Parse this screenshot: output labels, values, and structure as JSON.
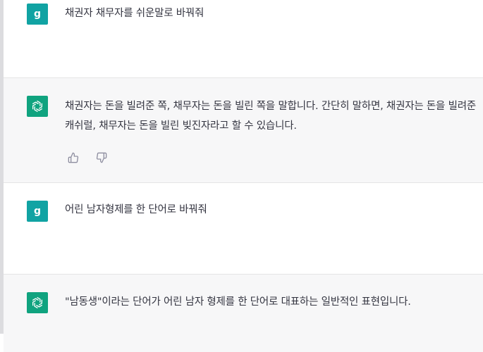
{
  "conversation": [
    {
      "role": "user",
      "avatar_letter": "g",
      "text": "채권자 채무자를 쉬운말로 바꿔줘"
    },
    {
      "role": "assistant",
      "text": "채권자는 돈을 빌려준 쪽, 채무자는 돈을 빌린 쪽을 말합니다. 간단히 말하면, 채권자는 돈을 빌려준 캐쉬럴, 채무자는 돈을 빌린 빚진자라고 할 수 있습니다."
    },
    {
      "role": "user",
      "avatar_letter": "g",
      "text": "어린 남자형제를 한 단어로 바꿔줘"
    },
    {
      "role": "assistant",
      "text": "\"남동생\"이라는 단어가 어린 남자 형제를 한 단어로 대표하는 일반적인 표현입니다."
    }
  ],
  "icons": {
    "assistant_avatar": "openai-logo-icon",
    "feedback_like": "thumbs-up-icon",
    "feedback_dislike": "thumbs-down-icon"
  },
  "colors": {
    "user_avatar_bg": "#11a3a3",
    "assistant_avatar_bg": "#10a37f",
    "assistant_row_bg": "#f7f7f8",
    "text": "#343541"
  }
}
